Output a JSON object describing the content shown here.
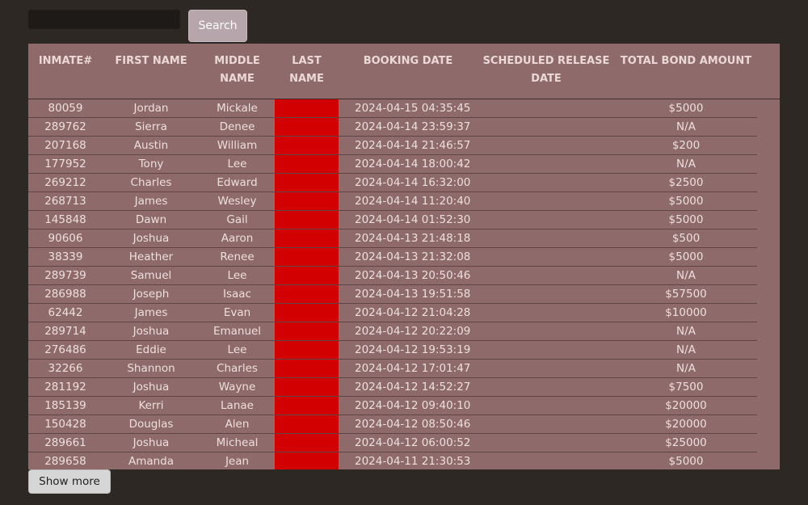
{
  "search": {
    "input_value": "",
    "placeholder": "",
    "button_label": "Search"
  },
  "table": {
    "headers": [
      "INMATE#",
      "FIRST NAME",
      "MIDDLE NAME",
      "LAST NAME",
      "BOOKING DATE",
      "SCHEDULED RELEASE DATE",
      "TOTAL BOND AMOUNT"
    ],
    "redaction_color": "#d20000",
    "rows": [
      {
        "inmate": "80059",
        "first": "Jordan",
        "middle": "Mickale",
        "last": "",
        "booking": "2024-04-15 04:35:45",
        "release": "",
        "bond": "$5000"
      },
      {
        "inmate": "289762",
        "first": "Sierra",
        "middle": "Denee",
        "last": "",
        "booking": "2024-04-14 23:59:37",
        "release": "",
        "bond": "N/A"
      },
      {
        "inmate": "207168",
        "first": "Austin",
        "middle": "William",
        "last": "",
        "booking": "2024-04-14 21:46:57",
        "release": "",
        "bond": "$200"
      },
      {
        "inmate": "177952",
        "first": "Tony",
        "middle": "Lee",
        "last": "",
        "booking": "2024-04-14 18:00:42",
        "release": "",
        "bond": "N/A"
      },
      {
        "inmate": "269212",
        "first": "Charles",
        "middle": "Edward",
        "last": "",
        "booking": "2024-04-14 16:32:00",
        "release": "",
        "bond": "$2500"
      },
      {
        "inmate": "268713",
        "first": "James",
        "middle": "Wesley",
        "last": "",
        "booking": "2024-04-14 11:20:40",
        "release": "",
        "bond": "$5000"
      },
      {
        "inmate": "145848",
        "first": "Dawn",
        "middle": "Gail",
        "last": "",
        "booking": "2024-04-14 01:52:30",
        "release": "",
        "bond": "$5000"
      },
      {
        "inmate": "90606",
        "first": "Joshua",
        "middle": "Aaron",
        "last": "",
        "booking": "2024-04-13 21:48:18",
        "release": "",
        "bond": "$500"
      },
      {
        "inmate": "38339",
        "first": "Heather",
        "middle": "Renee",
        "last": "",
        "booking": "2024-04-13 21:32:08",
        "release": "",
        "bond": "$5000"
      },
      {
        "inmate": "289739",
        "first": "Samuel",
        "middle": "Lee",
        "last": "",
        "booking": "2024-04-13 20:50:46",
        "release": "",
        "bond": "N/A"
      },
      {
        "inmate": "286988",
        "first": "Joseph",
        "middle": "Isaac",
        "last": "",
        "booking": "2024-04-13 19:51:58",
        "release": "",
        "bond": "$57500"
      },
      {
        "inmate": "62442",
        "first": "James",
        "middle": "Evan",
        "last": "",
        "booking": "2024-04-12 21:04:28",
        "release": "",
        "bond": "$10000"
      },
      {
        "inmate": "289714",
        "first": "Joshua",
        "middle": "Emanuel",
        "last": "",
        "booking": "2024-04-12 20:22:09",
        "release": "",
        "bond": "N/A"
      },
      {
        "inmate": "276486",
        "first": "Eddie",
        "middle": "Lee",
        "last": "",
        "booking": "2024-04-12 19:53:19",
        "release": "",
        "bond": "N/A"
      },
      {
        "inmate": "32266",
        "first": "Shannon",
        "middle": "Charles",
        "last": "",
        "booking": "2024-04-12 17:01:47",
        "release": "",
        "bond": "N/A"
      },
      {
        "inmate": "281192",
        "first": "Joshua",
        "middle": "Wayne",
        "last": "",
        "booking": "2024-04-12 14:52:27",
        "release": "",
        "bond": "$7500"
      },
      {
        "inmate": "185139",
        "first": "Kerri",
        "middle": "Lanae",
        "last": "",
        "booking": "2024-04-12 09:40:10",
        "release": "",
        "bond": "$20000"
      },
      {
        "inmate": "150428",
        "first": "Douglas",
        "middle": "Alen",
        "last": "",
        "booking": "2024-04-12 08:50:46",
        "release": "",
        "bond": "$20000"
      },
      {
        "inmate": "289661",
        "first": "Joshua",
        "middle": "Micheal",
        "last": "",
        "booking": "2024-04-12 06:00:52",
        "release": "",
        "bond": "$25000"
      },
      {
        "inmate": "289658",
        "first": "Amanda",
        "middle": "Jean",
        "last": "",
        "booking": "2024-04-11 21:30:53",
        "release": "",
        "bond": "$5000"
      }
    ]
  },
  "show_more": {
    "label": "Show more"
  }
}
